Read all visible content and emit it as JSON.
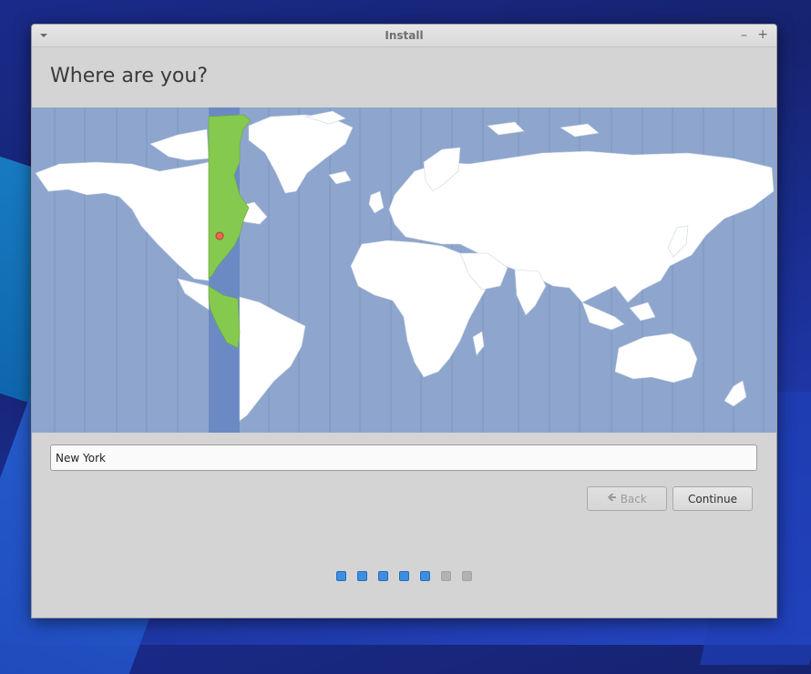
{
  "window": {
    "title": "Install"
  },
  "page": {
    "heading": "Where are you?"
  },
  "location": {
    "value": "New York"
  },
  "buttons": {
    "back_label": "Back",
    "continue_label": "Continue"
  },
  "progress": {
    "total_steps": 7,
    "completed_steps": 5
  },
  "colors": {
    "ocean": "#8ea6cd",
    "land": "#ffffff",
    "selected_zone": "#6b8ac4",
    "selected_land": "#85c94f",
    "marker": "#e8685a",
    "accent": "#3d8ee0"
  },
  "icons": {
    "window_menu": "chevron-down-icon",
    "minimize": "minimize-icon",
    "maximize": "maximize-icon",
    "back": "arrow-left-icon"
  }
}
